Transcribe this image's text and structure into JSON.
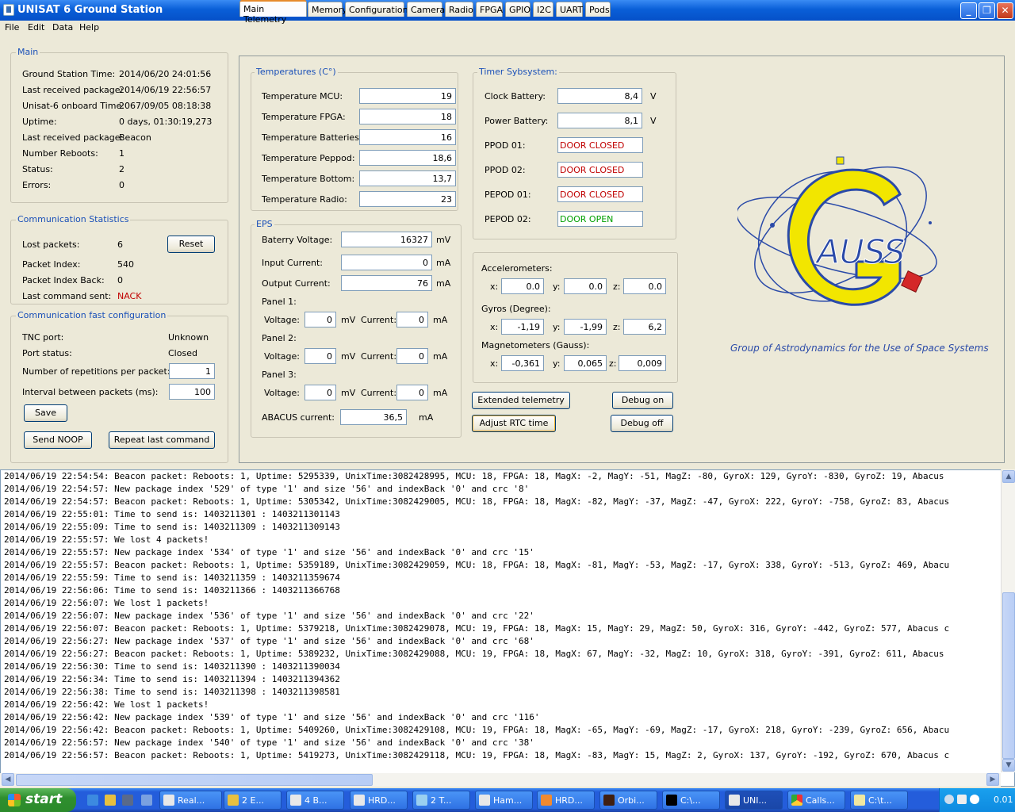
{
  "window": {
    "title": "UNISAT 6 Ground Station"
  },
  "menu": [
    "File",
    "Edit",
    "Data",
    "Help"
  ],
  "main": {
    "title": "Main",
    "rows": [
      {
        "label": "Ground Station Time:",
        "value": "2014/06/20 24:01:56"
      },
      {
        "label": "Last received package:",
        "value": "2014/06/19 22:56:57"
      },
      {
        "label": "Unisat-6 onboard Time:",
        "value": "2067/09/05 08:18:38"
      },
      {
        "label": "Uptime:",
        "value": "0 days, 01:30:19,273"
      },
      {
        "label": "Last received package:",
        "value": "Beacon"
      },
      {
        "label": "Number Reboots:",
        "value": "1"
      },
      {
        "label": "Status:",
        "value": "2"
      },
      {
        "label": "Errors:",
        "value": "0"
      }
    ]
  },
  "comm_stats": {
    "title": "Communication Statistics",
    "lost_label": "Lost packets:",
    "lost_value": "6",
    "reset": "Reset",
    "index_label": "Packet Index:",
    "index_value": "540",
    "indexback_label": "Packet Index Back:",
    "indexback_value": "0",
    "lastcmd_label": "Last command sent:",
    "lastcmd_value": "NACK"
  },
  "comm_config": {
    "title": "Communication fast configuration",
    "tnc_label": "TNC port:",
    "tnc_value": "Unknown",
    "status_label": "Port status:",
    "status_value": "Closed",
    "rep_label": "Number of repetitions per packet:",
    "rep_value": "1",
    "interval_label": "Interval between packets (ms):",
    "interval_value": "100",
    "save": "Save",
    "noop": "Send NOOP",
    "repeat": "Repeat last command"
  },
  "tabs": [
    "Main Telemetry",
    "Memory",
    "Configuration",
    "Camera",
    "Radio",
    "FPGA",
    "GPIO",
    "I2C",
    "UART",
    "Pods"
  ],
  "temperatures": {
    "title": "Temperatures (C°)",
    "rows": [
      {
        "label": "Temperature MCU:",
        "value": "19"
      },
      {
        "label": "Temperature FPGA:",
        "value": "18"
      },
      {
        "label": "Temperature Batteries:",
        "value": "16"
      },
      {
        "label": "Temperature Peppod:",
        "value": "18,6"
      },
      {
        "label": "Temperature Bottom:",
        "value": "13,7"
      },
      {
        "label": "Temperature Radio:",
        "value": "23"
      }
    ]
  },
  "eps": {
    "title": "EPS",
    "battery_label": "Baterry Voltage:",
    "battery_value": "16327",
    "battery_unit": "mV",
    "input_label": "Input Current:",
    "input_value": "0",
    "input_unit": "mA",
    "output_label": "Output Current:",
    "output_value": "76",
    "output_unit": "mA",
    "voltage_label": "Voltage:",
    "current_label": "Current:",
    "mv": "mV",
    "ma": "mA",
    "panels": [
      {
        "name": "Panel 1:",
        "voltage": "0",
        "current": "0"
      },
      {
        "name": "Panel 2:",
        "voltage": "0",
        "current": "0"
      },
      {
        "name": "Panel 3:",
        "voltage": "0",
        "current": "0"
      }
    ],
    "abacus_label": "ABACUS current:",
    "abacus_value": "36,5",
    "abacus_unit": "mA"
  },
  "timer": {
    "title": "Timer Sybsystem:",
    "clock_label": "Clock Battery:",
    "clock_value": "8,4",
    "clock_unit": "V",
    "power_label": "Power Battery:",
    "power_value": "8,1",
    "power_unit": "V",
    "pods": [
      {
        "label": "PPOD 01:",
        "value": "DOOR CLOSED"
      },
      {
        "label": "PPOD 02:",
        "value": "DOOR CLOSED"
      },
      {
        "label": "PEPOD 01:",
        "value": "DOOR CLOSED"
      },
      {
        "label": "PEPOD 02:",
        "value": "DOOR OPEN"
      }
    ]
  },
  "sensors": {
    "acc_title": "Accelerometers:",
    "acc": [
      "0.0",
      "0.0",
      "0.0"
    ],
    "gyro_title": "Gyros (Degree):",
    "gyro": [
      "-1,19",
      "-1,99",
      "6,2"
    ],
    "mag_title": "Magnetometers (Gauss):",
    "mag": [
      "-0,361",
      "0,065",
      "0,009"
    ],
    "x": "x:",
    "y": "y:",
    "z": "z:"
  },
  "actions": {
    "extended": "Extended telemetry",
    "debug_on": "Debug on",
    "rtc": "Adjust RTC time",
    "debug_off": "Debug off"
  },
  "logo": {
    "letters": "AUSS",
    "tagline": "Group of Astrodynamics for the Use of Space Systems"
  },
  "log": [
    "2014/06/19 22:54:54: Beacon packet: Reboots: 1, Uptime: 5295339, UnixTime:3082428995, MCU: 18, FPGA: 18, MagX: -2, MagY: -51, MagZ: -80, GyroX: 129, GyroY: -830, GyroZ: 19, Abacus",
    "2014/06/19 22:54:57: New package index '529' of type '1' and size '56' and indexBack '0' and crc '8'",
    "2014/06/19 22:54:57: Beacon packet: Reboots: 1, Uptime: 5305342, UnixTime:3082429005, MCU: 18, FPGA: 18, MagX: -82, MagY: -37, MagZ: -47, GyroX: 222, GyroY: -758, GyroZ: 83, Abacus",
    "2014/06/19 22:55:01: Time to send is: 1403211301 : 1403211301143",
    "2014/06/19 22:55:09: Time to send is: 1403211309 : 1403211309143",
    "2014/06/19 22:55:57: We lost 4 packets!",
    "2014/06/19 22:55:57: New package index '534' of type '1' and size '56' and indexBack '0' and crc '15'",
    "2014/06/19 22:55:57: Beacon packet: Reboots: 1, Uptime: 5359189, UnixTime:3082429059, MCU: 18, FPGA: 18, MagX: -81, MagY: -53, MagZ: -17, GyroX: 338, GyroY: -513, GyroZ: 469, Abacu",
    "2014/06/19 22:55:59: Time to send is: 1403211359 : 1403211359674",
    "2014/06/19 22:56:06: Time to send is: 1403211366 : 1403211366768",
    "2014/06/19 22:56:07: We lost 1 packets!",
    "2014/06/19 22:56:07: New package index '536' of type '1' and size '56' and indexBack '0' and crc '22'",
    "2014/06/19 22:56:07: Beacon packet: Reboots: 1, Uptime: 5379218, UnixTime:3082429078, MCU: 19, FPGA: 18, MagX: 15, MagY: 29, MagZ: 50, GyroX: 316, GyroY: -442, GyroZ: 577, Abacus c",
    "2014/06/19 22:56:27: New package index '537' of type '1' and size '56' and indexBack '0' and crc '68'",
    "2014/06/19 22:56:27: Beacon packet: Reboots: 1, Uptime: 5389232, UnixTime:3082429088, MCU: 19, FPGA: 18, MagX: 67, MagY: -32, MagZ: 10, GyroX: 318, GyroY: -391, GyroZ: 611, Abacus",
    "2014/06/19 22:56:30: Time to send is: 1403211390 : 1403211390034",
    "2014/06/19 22:56:34: Time to send is: 1403211394 : 1403211394362",
    "2014/06/19 22:56:38: Time to send is: 1403211398 : 1403211398581",
    "2014/06/19 22:56:42: We lost 1 packets!",
    "2014/06/19 22:56:42: New package index '539' of type '1' and size '56' and indexBack '0' and crc '116'",
    "2014/06/19 22:56:42: Beacon packet: Reboots: 1, Uptime: 5409260, UnixTime:3082429108, MCU: 19, FPGA: 18, MagX: -65, MagY: -69, MagZ: -17, GyroX: 218, GyroY: -239, GyroZ: 656, Abacu",
    "2014/06/19 22:56:57: New package index '540' of type '1' and size '56' and indexBack '0' and crc '38'",
    "2014/06/19 22:56:57: Beacon packet: Reboots: 1, Uptime: 5419273, UnixTime:3082429118, MCU: 19, FPGA: 18, MagX: -83, MagY: 15, MagZ: 2, GyroX: 137, GyroY: -192, GyroZ: 670, Abacus c"
  ],
  "taskbar": {
    "start": "start",
    "items": [
      "Real...",
      "2 E...",
      "4 B...",
      "HRD...",
      "2 T...",
      "Ham...",
      "HRD...",
      "Orbi...",
      "C:\\...",
      "UNI...",
      "Calls...",
      "C:\\t..."
    ],
    "clock": "0.01"
  },
  "colors": {
    "accent": "#1a50b8",
    "error": "#c00000",
    "ok": "#00a000",
    "logo_yellow": "#f2e600",
    "logo_blue": "#2a4aa8"
  }
}
